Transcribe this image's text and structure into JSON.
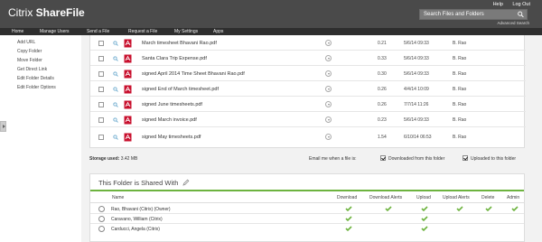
{
  "header": {
    "logo_part1": "Citrix ",
    "logo_part2": "ShareFile",
    "help": "Help",
    "logout": "Log Out",
    "search_placeholder": "Search Files and Folders",
    "advanced_search": "Advanced Search"
  },
  "nav": [
    "Home",
    "Manage Users",
    "Send a File",
    "Request a File",
    "My Settings",
    "Apps"
  ],
  "sidebar": {
    "links": [
      "Add URL",
      "Copy Folder",
      "Move Folder",
      "Get Direct Link",
      "Edit Folder Details",
      "Edit Folder Options"
    ]
  },
  "files": [
    {
      "name": "March timesheet Bhavani Rao.pdf",
      "size": "0.21",
      "date": "5/6/14 09:33",
      "by": "B. Rao"
    },
    {
      "name": "Santa Clara Trip Expense.pdf",
      "size": "0.33",
      "date": "5/6/14 09:33",
      "by": "B. Rao"
    },
    {
      "name": "signed April 2014 Time Sheet Bhavani Rao.pdf",
      "size": "0.30",
      "date": "5/6/14 09:33",
      "by": "B. Rao"
    },
    {
      "name": "signed End of March timesheet.pdf",
      "size": "0.26",
      "date": "4/4/14 10:09",
      "by": "B. Rao"
    },
    {
      "name": "signed June timesheets.pdf",
      "size": "0.26",
      "date": "7/7/14 11:26",
      "by": "B. Rao"
    },
    {
      "name": "signed March invoice.pdf",
      "size": "0.23",
      "date": "5/6/14 09:33",
      "by": "B. Rao"
    },
    {
      "name": "signed May timesheets.pdf",
      "size": "1.54",
      "date": "6/10/14 06:53",
      "by": "B. Rao"
    }
  ],
  "storage": {
    "label": "Storage used:",
    "value": "3.42 MB"
  },
  "email": {
    "label": "Email me when a file is:",
    "downloaded": "Downloaded from this folder",
    "uploaded": "Uploaded to this folder"
  },
  "shared": {
    "title": "This Folder is Shared With",
    "columns": [
      "Name",
      "Download",
      "Download Alerts",
      "Upload",
      "Upload Alerts",
      "Delete",
      "Admin"
    ],
    "users": [
      {
        "name": "Rao, Bhavani (Citrix) (Owner)",
        "perms": [
          true,
          true,
          true,
          true,
          true,
          true
        ]
      },
      {
        "name": "Caravano, William (Citrix)",
        "perms": [
          true,
          false,
          true,
          false,
          false,
          false
        ]
      },
      {
        "name": "Carducci, Angela (Citrix)",
        "perms": [
          true,
          false,
          true,
          false,
          false,
          false
        ]
      }
    ]
  },
  "colors": {
    "accent_green": "#6db33f",
    "pdf_red": "#c8102e",
    "header_bg": "#4a4a4a",
    "nav_bg": "#2e2e2e"
  }
}
